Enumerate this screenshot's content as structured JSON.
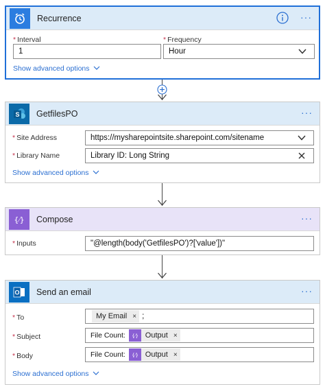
{
  "recurrence": {
    "title": "Recurrence",
    "interval_label": "Interval",
    "interval_value": "1",
    "frequency_label": "Frequency",
    "frequency_value": "Hour",
    "advanced_label": "Show advanced options"
  },
  "getfiles": {
    "title": "GetfilesPO",
    "site_label": "Site Address",
    "site_value": "https://mysharepointsite.sharepoint.com/sitename",
    "library_label": "Library Name",
    "library_value": "Library ID: Long String",
    "advanced_label": "Show advanced options"
  },
  "compose": {
    "title": "Compose",
    "inputs_label": "Inputs",
    "inputs_value": "\"@length(body('GetfilesPO')?['value'])\""
  },
  "email": {
    "title": "Send an email",
    "to_label": "To",
    "to_token": "My Email",
    "to_suffix": ";",
    "subject_label": "Subject",
    "subject_prefix": "File Count:",
    "subject_token": "Output",
    "body_label": "Body",
    "body_prefix": "File Count:",
    "body_token": "Output",
    "advanced_label": "Show advanced options"
  },
  "icons": {
    "required_mark": "*",
    "remove_mark": "×",
    "more_mark": "···"
  },
  "colors": {
    "accent": "#1f6fd8",
    "recurrence_icon": "#2b7de0",
    "sharepoint_icon": "#0b6aa8",
    "compose_icon": "#8a5fd4",
    "outlook_icon": "#0a6fc2",
    "required": "#c4314b"
  }
}
